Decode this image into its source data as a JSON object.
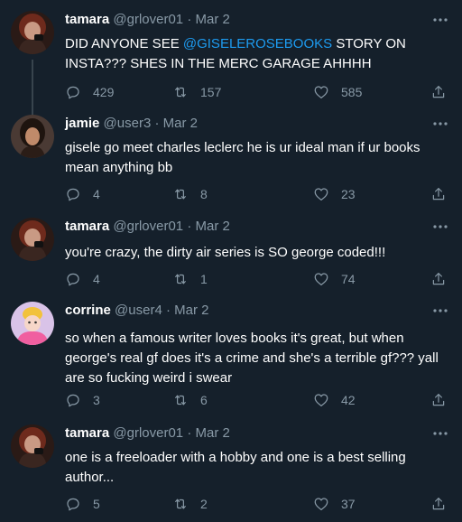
{
  "colors": {
    "background": "#15202b",
    "text": "#ffffff",
    "muted": "#8899a6",
    "link": "#1d9bf0",
    "thread_line": "#38444d"
  },
  "tweets": [
    {
      "name": "tamara",
      "handle": "@grlover01",
      "date": "Mar 2",
      "text_before": "DID ANYONE SEE ",
      "mention": "@GISELEROSEBOOKS",
      "text_after": " STORY ON INSTA??? SHES IN THE MERC GARAGE AHHHH",
      "replies": "429",
      "retweets": "157",
      "likes": "585",
      "avatar": "avatar-tamara"
    },
    {
      "name": "jamie",
      "handle": "@user3",
      "date": "Mar 2",
      "text": "gisele go meet charles leclerc he is ur ideal man if ur books mean anything bb",
      "replies": "4",
      "retweets": "8",
      "likes": "23",
      "avatar": "avatar-jamie"
    },
    {
      "name": "tamara",
      "handle": "@grlover01",
      "date": "Mar 2",
      "text": "you're crazy, the dirty air series is SO george coded!!!",
      "replies": "4",
      "retweets": "1",
      "likes": "74",
      "avatar": "avatar-tamara"
    },
    {
      "name": "corrine",
      "handle": "@user4",
      "date": "Mar 2",
      "text": "so when a famous writer loves books it's great, but when george's real gf does it's a crime and she's a terrible gf??? yall are so fucking weird i swear",
      "replies": "3",
      "retweets": "6",
      "likes": "42",
      "avatar": "avatar-corrine"
    },
    {
      "name": "tamara",
      "handle": "@grlover01",
      "date": "Mar 2",
      "text": "one is a freeloader with a hobby and one is a best selling author...",
      "replies": "5",
      "retweets": "2",
      "likes": "37",
      "avatar": "avatar-tamara"
    }
  ],
  "separator": "·",
  "icons": {
    "reply": "reply-icon",
    "retweet": "retweet-icon",
    "like": "heart-icon",
    "share": "share-icon",
    "more": "more-icon"
  }
}
